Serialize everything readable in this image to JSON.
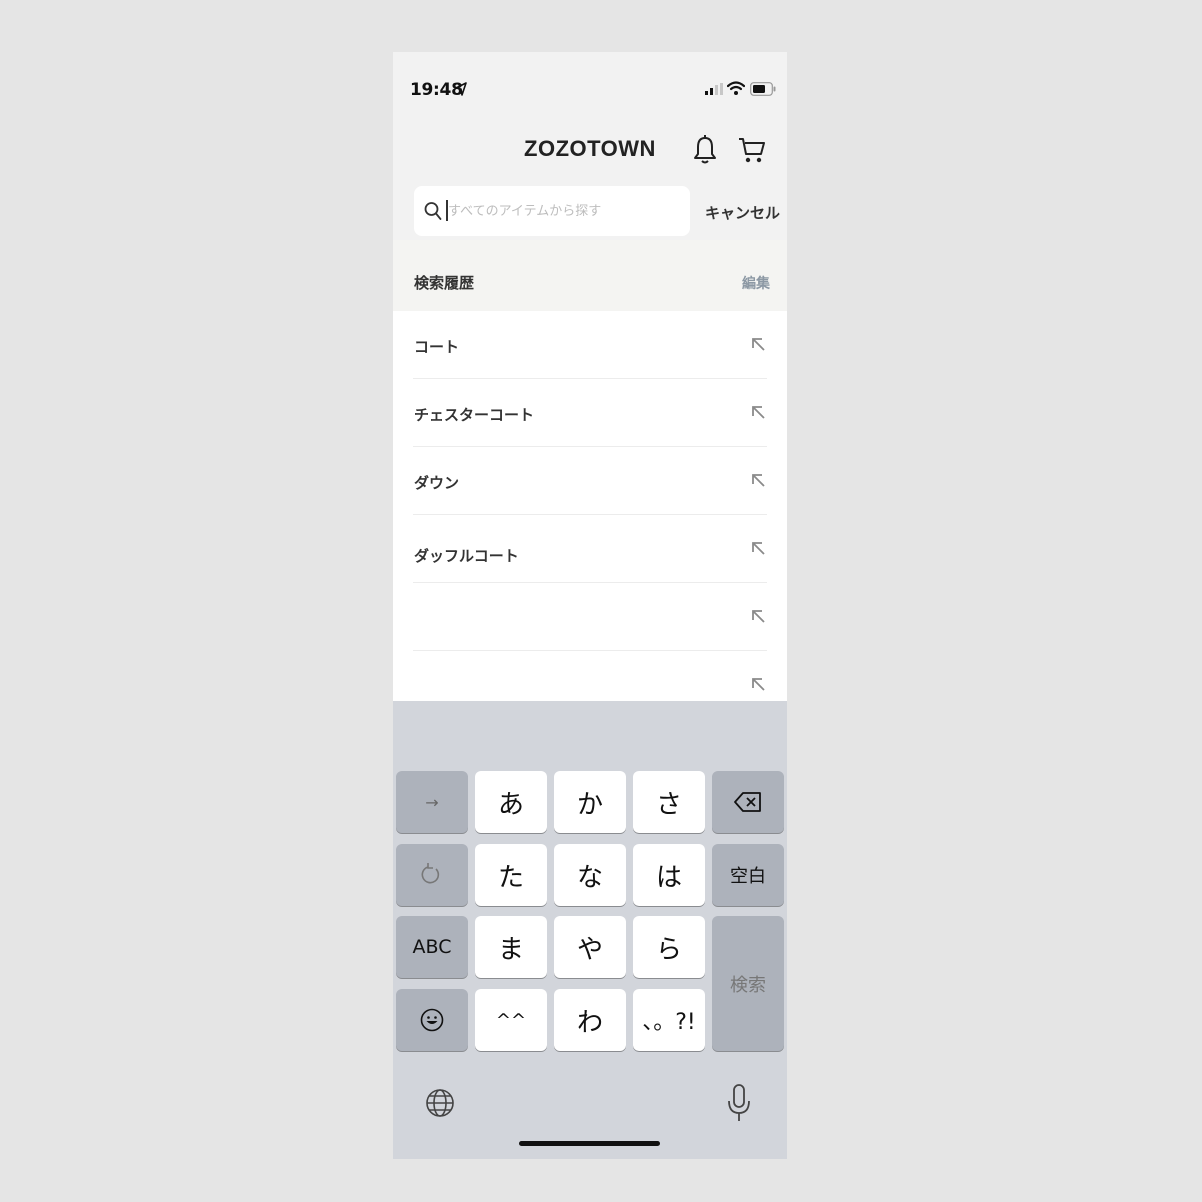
{
  "status_bar": {
    "time": "19:48",
    "icons": [
      "location-arrow-icon",
      "signal-icon",
      "wifi-icon",
      "battery-icon"
    ]
  },
  "header": {
    "logo": "ZOZOTOWN",
    "icons": [
      "bell-icon",
      "cart-icon"
    ]
  },
  "search": {
    "placeholder": "すべてのアイテムから探す",
    "value": "",
    "cancel_label": "キャンセル"
  },
  "history": {
    "title": "検索履歴",
    "edit_label": "編集",
    "items": [
      {
        "label": "コート"
      },
      {
        "label": "チェスターコート"
      },
      {
        "label": "ダウン"
      },
      {
        "label": "ダッフルコート"
      },
      {
        "label": ""
      },
      {
        "label": ""
      }
    ]
  },
  "keyboard": {
    "next_key": "→",
    "kana_row1": [
      "あ",
      "か",
      "さ"
    ],
    "kana_row2": [
      "た",
      "な",
      "は"
    ],
    "kana_row3": [
      "ま",
      "や",
      "ら"
    ],
    "kana_row4": [
      "^^",
      "わ",
      "、。?!"
    ],
    "space_label": "空白",
    "abc_label": "ABC",
    "search_label": "検索",
    "icons": [
      "delete-icon",
      "undo-icon",
      "emoji-icon",
      "globe-icon",
      "microphone-icon"
    ]
  },
  "colors": {
    "edit_accent": "#8c98a4",
    "keyboard_bg": "#d2d5db"
  }
}
